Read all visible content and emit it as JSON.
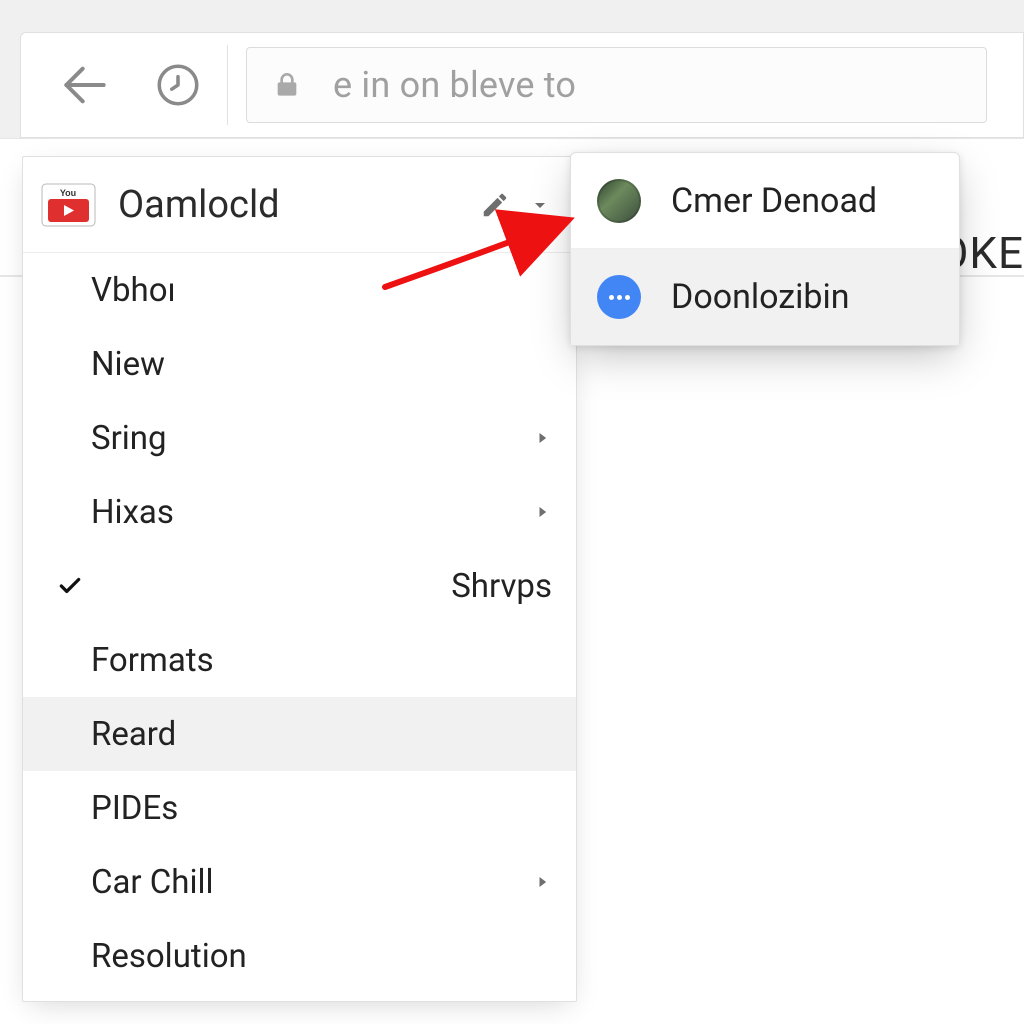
{
  "toolbar": {
    "address_placeholder": "e in on bleve to"
  },
  "leftPanel": {
    "title": "Oamlocld",
    "items": [
      {
        "label": "Vbhoı",
        "submenu": false,
        "checked": false,
        "highlight": false
      },
      {
        "label": "Niew",
        "submenu": false,
        "checked": false,
        "highlight": false
      },
      {
        "label": "Sring",
        "submenu": true,
        "checked": false,
        "highlight": false
      },
      {
        "label": "Hixas",
        "submenu": true,
        "checked": false,
        "highlight": false
      },
      {
        "label": "Shrvps",
        "submenu": false,
        "checked": true,
        "highlight": false
      },
      {
        "label": "Formats",
        "submenu": false,
        "checked": false,
        "highlight": false
      },
      {
        "label": "Reard",
        "submenu": false,
        "checked": false,
        "highlight": true
      },
      {
        "label": "PIDEs",
        "submenu": false,
        "checked": false,
        "highlight": false
      },
      {
        "label": "Car Chill",
        "submenu": true,
        "checked": false,
        "highlight": false
      },
      {
        "label": "Resolution",
        "submenu": false,
        "checked": false,
        "highlight": false
      }
    ]
  },
  "rightPanel": {
    "items": [
      {
        "label": "Cmer Denoad",
        "avatar": "photo",
        "highlight": false
      },
      {
        "label": "Doonlozibin",
        "avatar": "blue-dots",
        "highlight": true
      }
    ]
  },
  "background": {
    "partial_text": "OKE"
  }
}
